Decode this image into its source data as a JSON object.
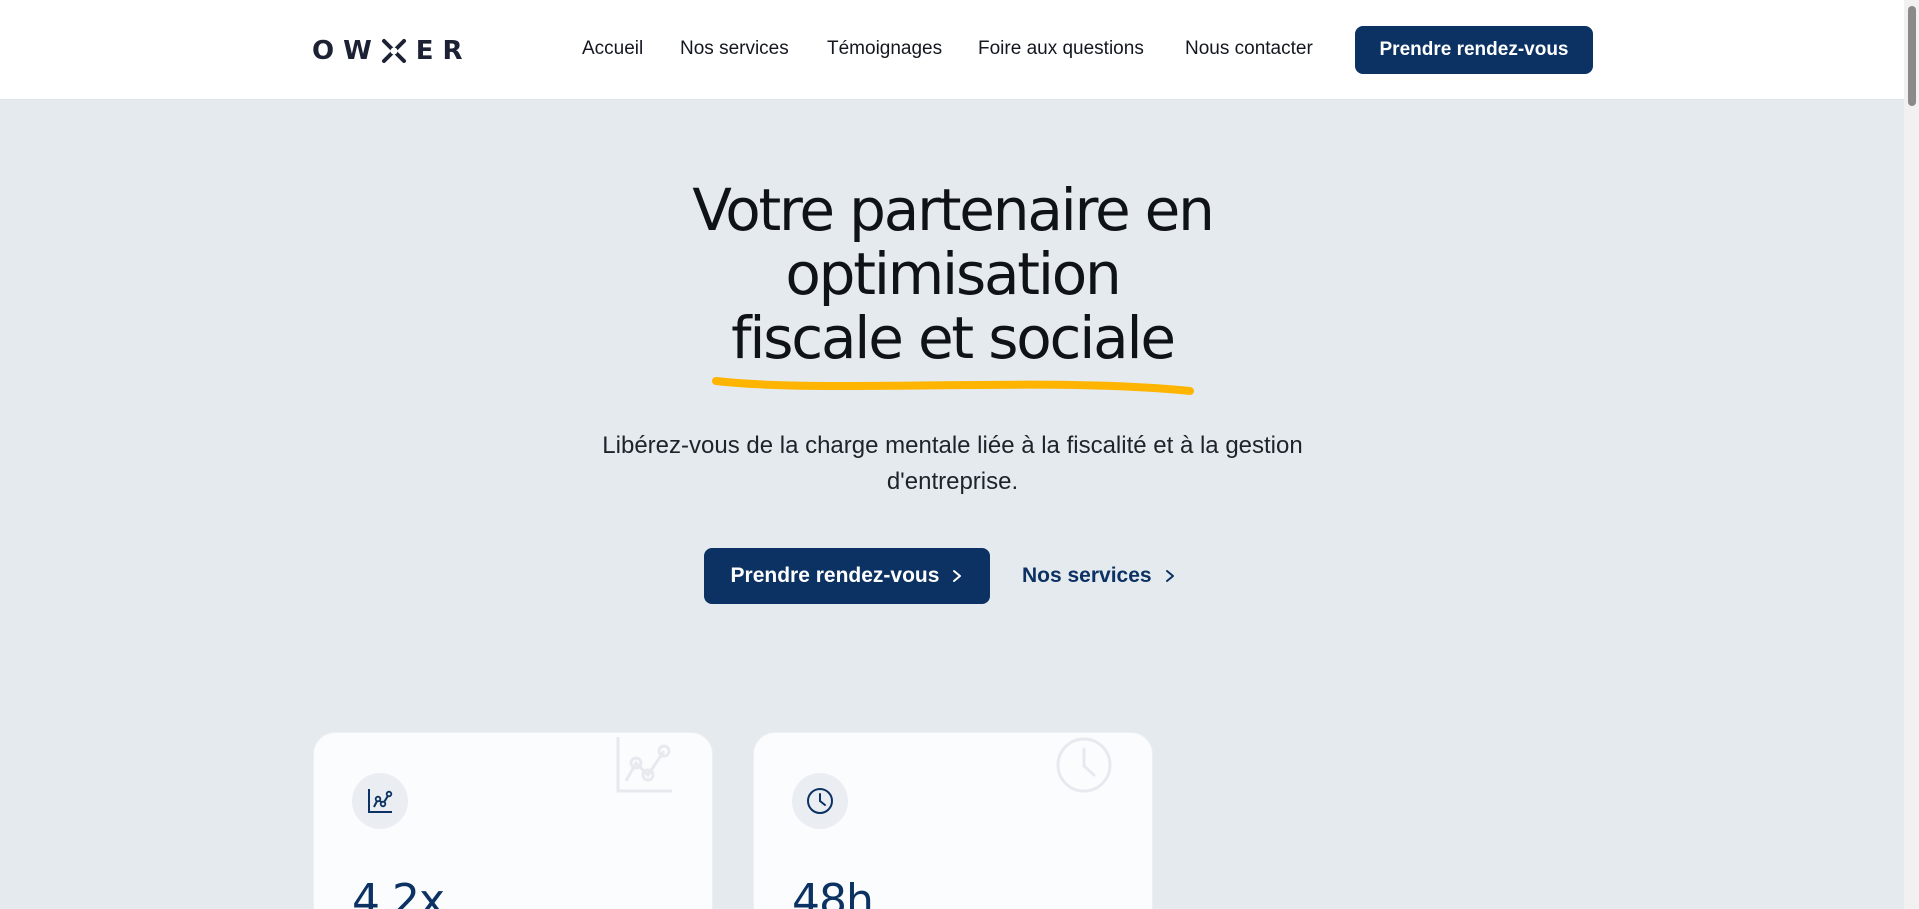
{
  "brand": {
    "logo_text": "OWNER",
    "logo_rest": "ER",
    "logo_prefix": "OW"
  },
  "nav": {
    "items": [
      {
        "label": "Accueil"
      },
      {
        "label": "Nos services"
      },
      {
        "label": "Témoignages"
      },
      {
        "label": "Foire aux questions"
      },
      {
        "label": "Nous contacter"
      }
    ],
    "cta_label": "Prendre rendez-vous"
  },
  "hero": {
    "title_line1": "Votre partenaire en",
    "title_line2": "optimisation",
    "title_line3": "fiscale et sociale",
    "subtitle": "Libérez-vous de la charge mentale liée à la fiscalité et à la gestion d'entreprise.",
    "primary_cta": "Prendre rendez-vous",
    "secondary_cta": "Nos services"
  },
  "stats": [
    {
      "value": "4,2x",
      "icon": "chart-icon"
    },
    {
      "value": "48h",
      "icon": "clock-icon"
    }
  ],
  "colors": {
    "accent": "#0c3263",
    "highlight": "#ffb400",
    "background": "#e5eaee"
  }
}
